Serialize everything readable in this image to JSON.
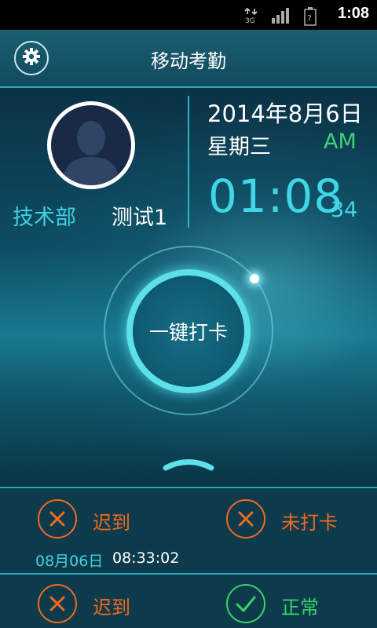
{
  "status_bar": {
    "time": "1:08",
    "icons": [
      "data-3g-icon",
      "signal-bars-icon",
      "battery-unknown-icon"
    ]
  },
  "header": {
    "title": "移动考勤",
    "settings_icon": "gear-icon"
  },
  "profile": {
    "department": "技术部",
    "name": "测试1"
  },
  "datetime": {
    "date": "2014年8月6日",
    "weekday": "星期三",
    "ampm": "AM",
    "time": "01:08",
    "seconds": "34"
  },
  "punch": {
    "label": "一键打卡"
  },
  "records": {
    "row1": {
      "left": {
        "status": "迟到",
        "icon": "close-icon"
      },
      "right": {
        "status": "未打卡",
        "icon": "close-icon"
      },
      "date": "08月06日",
      "time": "08:33:02"
    },
    "row2": {
      "left": {
        "status": "迟到",
        "icon": "close-icon"
      },
      "right": {
        "status": "正常",
        "icon": "check-icon"
      }
    }
  },
  "colors": {
    "accent": "#3fd6e6",
    "late": "#f06a1e",
    "normal": "#3cd268"
  }
}
